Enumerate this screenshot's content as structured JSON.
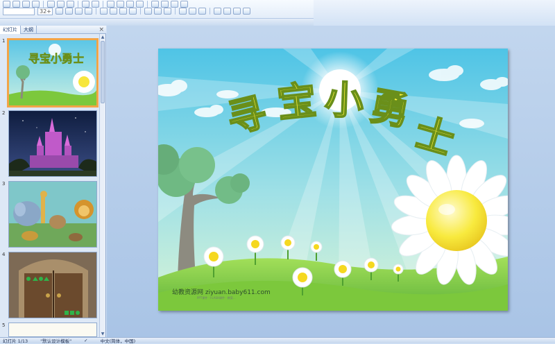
{
  "panel": {
    "tabs": [
      "幻灯片",
      "大纲"
    ],
    "close_glyph": "×",
    "slide_numbers": [
      "1",
      "2",
      "3",
      "4",
      "5"
    ]
  },
  "slide": {
    "title_chars": [
      "寻",
      "宝",
      "小",
      "勇",
      "士"
    ],
    "watermark": "幼教资源网 ziyuan.baby611.com",
    "watermark_sub": "PPT课件 · FLASH课件 · 教案…"
  },
  "status": {
    "slide_info": "幻灯片 1/13",
    "theme": "\"默认设计模板\"",
    "language": "中文(简体，中国)"
  },
  "ribbon": {
    "font_size_value": "32+"
  },
  "colors": {
    "title_fill": "#fff43a",
    "selection": "#f3a447",
    "sky_top": "#5fcde8",
    "grass": "#7cc83c"
  }
}
